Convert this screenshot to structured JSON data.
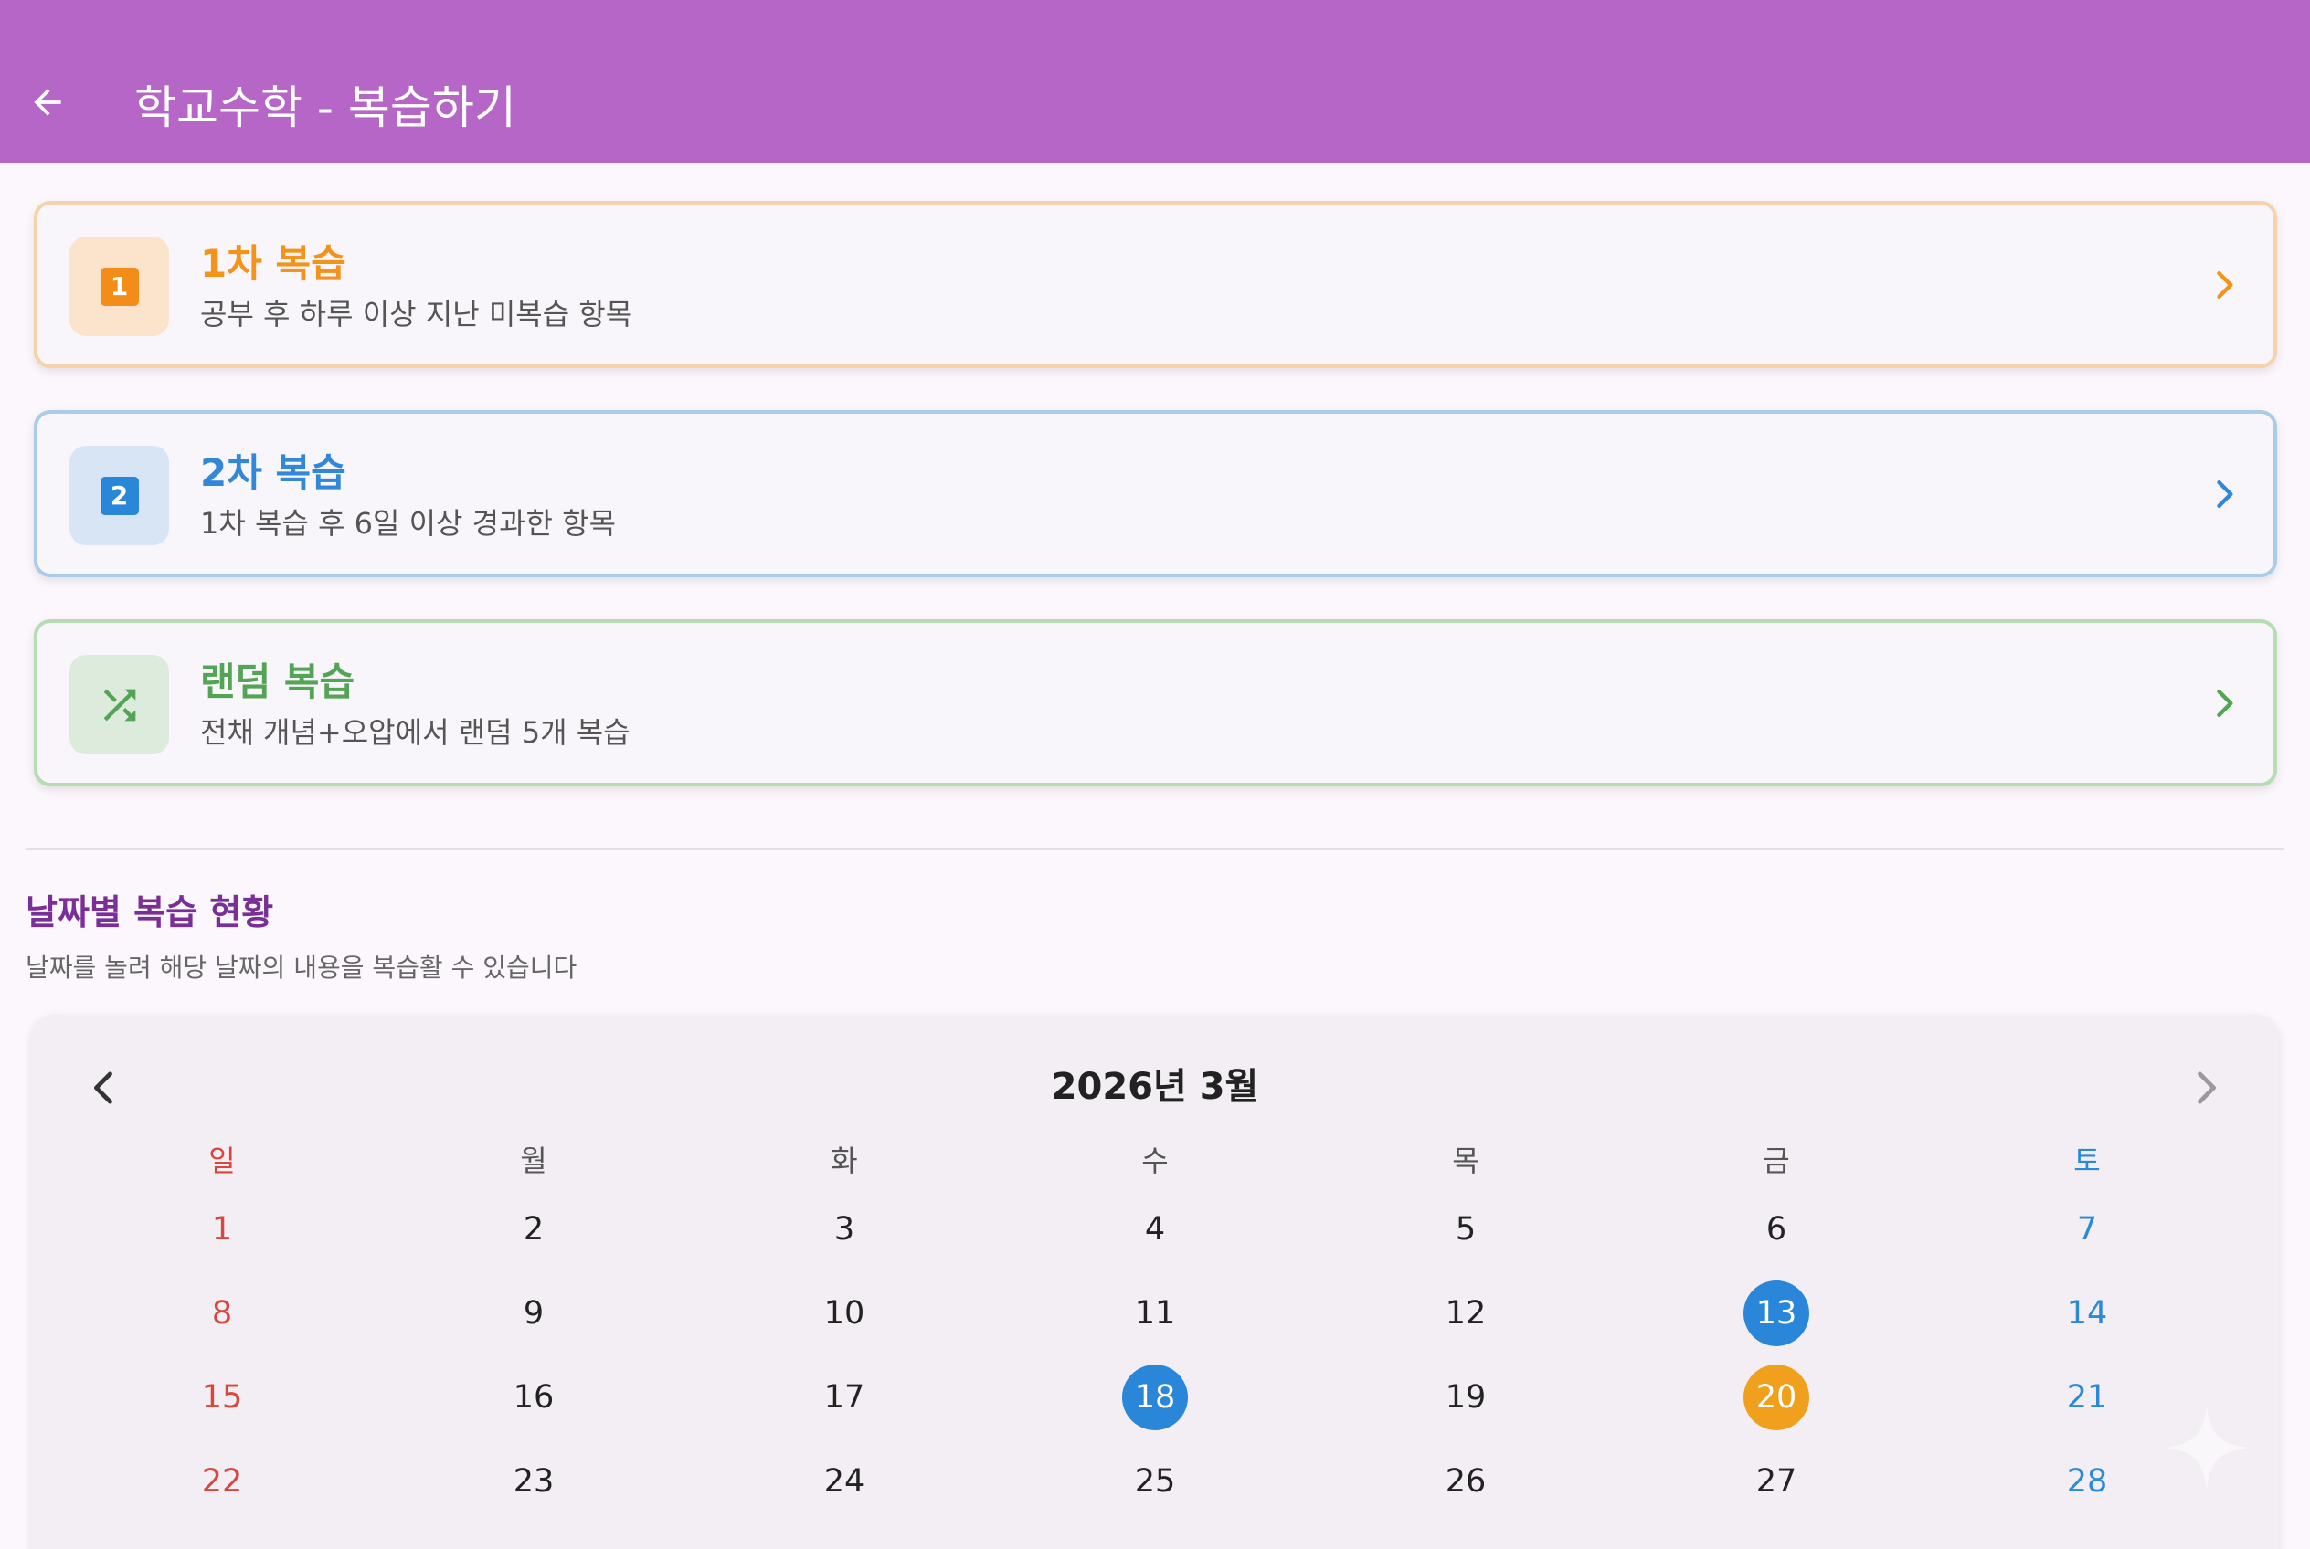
{
  "appbar": {
    "title": "학교수학 - 복습하기",
    "color": "#b566c7"
  },
  "review_cards": [
    {
      "id": "first",
      "icon_text": "1",
      "title": "1차 복습",
      "description": "공부 후 하루 이상 지난 미복습 항목",
      "accent": "#f39319"
    },
    {
      "id": "second",
      "icon_text": "2",
      "title": "2차 복습",
      "description": "1차 복습 후 6일 이상 경과한 항목",
      "accent": "#3288d6"
    },
    {
      "id": "random",
      "icon": "shuffle-icon",
      "title": "랜덤 복습",
      "description": "전채 개념+오압에서 랜덤 5개 복습",
      "accent": "#54a455"
    }
  ],
  "section": {
    "title": "날짜별 복습 현황",
    "subtitle": "날짜를 놀려 해당 날짜의 내용을 복습활 수 있습니다"
  },
  "calendar": {
    "month_label": "2026년 3월",
    "weekdays": [
      "일",
      "월",
      "화",
      "수",
      "목",
      "금",
      "토"
    ],
    "weeks": [
      [
        "1",
        "2",
        "3",
        "4",
        "5",
        "6",
        "7"
      ],
      [
        "8",
        "9",
        "10",
        "11",
        "12",
        "13",
        "14"
      ],
      [
        "15",
        "16",
        "17",
        "18",
        "19",
        "20",
        "21"
      ],
      [
        "22",
        "23",
        "24",
        "25",
        "26",
        "27",
        "28"
      ]
    ],
    "marked_days": {
      "13": "blue",
      "18": "blue",
      "20": "orange"
    },
    "colors": {
      "sunday": "#d9463e",
      "saturday": "#2a8ad6",
      "mark_blue": "#2a86d8",
      "mark_orange": "#f0a01c"
    }
  }
}
